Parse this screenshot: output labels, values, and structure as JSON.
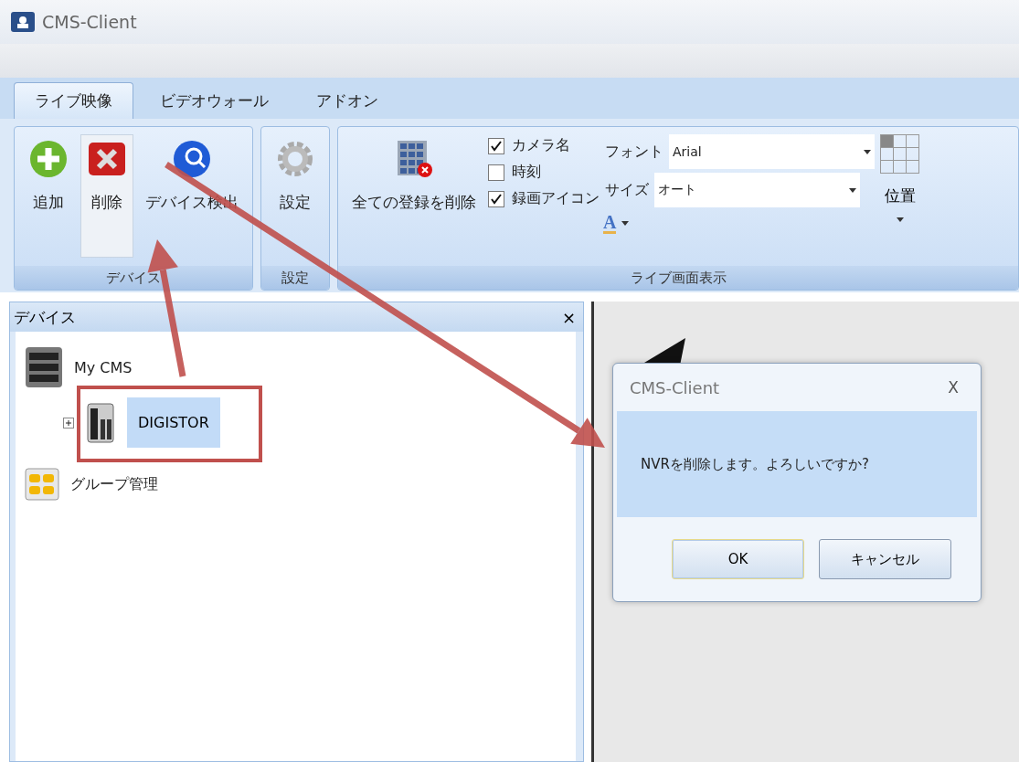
{
  "window": {
    "title": "CMS-Client"
  },
  "ribbon": {
    "tabs": [
      {
        "label": "ライブ映像",
        "selected": true
      },
      {
        "label": "ビデオウォール",
        "selected": false
      },
      {
        "label": "アドオン",
        "selected": false
      }
    ],
    "groups": [
      {
        "kind": "device",
        "label": "デバイス",
        "buttons": [
          {
            "kind": "add",
            "label": "追加",
            "highlighted": false
          },
          {
            "kind": "delete",
            "label": "削除",
            "highlighted": true
          },
          {
            "kind": "discover",
            "label": "デバイス検出",
            "highlighted": false
          }
        ]
      },
      {
        "kind": "settings",
        "label": "設定",
        "buttons": [
          {
            "kind": "gear",
            "label": "設定",
            "highlighted": false
          }
        ]
      },
      {
        "kind": "display",
        "label": "ライブ画面表示",
        "delete_all": {
          "label": "全ての登録を削除"
        },
        "checkboxes": [
          {
            "label": "カメラ名",
            "checked": true
          },
          {
            "label": "時刻",
            "checked": false
          },
          {
            "label": "録画アイコン",
            "checked": true
          }
        ],
        "font": {
          "label": "フォント",
          "value": "Arial"
        },
        "size": {
          "label": "サイズ",
          "value": "オート"
        },
        "font_color": {
          "glyph": "A"
        },
        "position": {
          "label": "位置"
        }
      }
    ]
  },
  "device_panel": {
    "title": "デバイス",
    "close": "×",
    "tree": [
      {
        "kind": "server",
        "label": "My CMS",
        "children": [
          {
            "kind": "nvr",
            "label": "DIGISTOR",
            "selected": true,
            "expanded": false
          }
        ]
      },
      {
        "kind": "group",
        "label": "グループ管理"
      }
    ]
  },
  "dialog": {
    "title": "CMS-Client",
    "close": "X",
    "message": "NVRを削除します。よろしいですか?",
    "buttons": [
      {
        "label": "OK",
        "default": true
      },
      {
        "label": "キャンセル",
        "default": false
      }
    ]
  }
}
